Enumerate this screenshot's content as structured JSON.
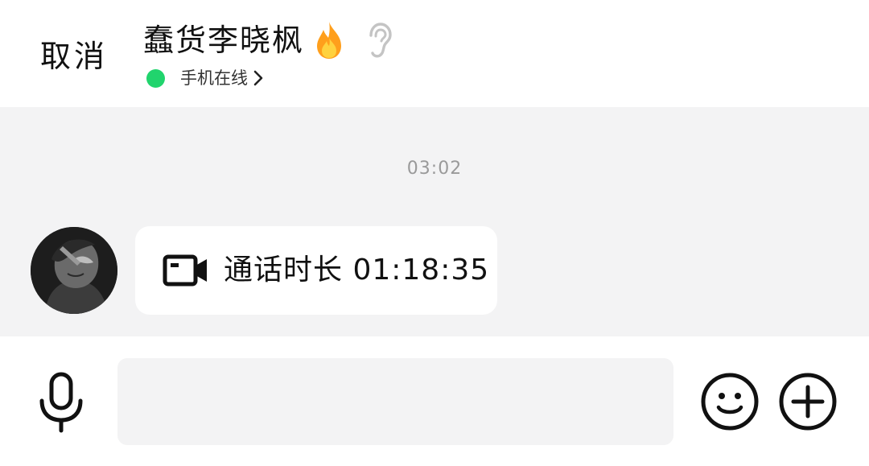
{
  "header": {
    "cancel_label": "取消",
    "contact_name": "蠢货李晓枫",
    "status_text": "手机在线",
    "icons": {
      "status_emoji": "fire-icon",
      "ear_mode": "ear-icon",
      "status_arrow": "chevron-right-icon"
    },
    "online_color": "#21d46d"
  },
  "chat": {
    "background_color": "#f3f3f4",
    "timestamp": "03:02",
    "messages": [
      {
        "sender": "other",
        "type": "video-call",
        "icon": "video-call-icon",
        "text": "通话时长 01:18:35"
      }
    ]
  },
  "input_bar": {
    "message_value": "",
    "placeholder": "",
    "icons": {
      "voice": "microphone-icon",
      "emoji": "smiley-icon",
      "more": "plus-circle-icon"
    }
  }
}
